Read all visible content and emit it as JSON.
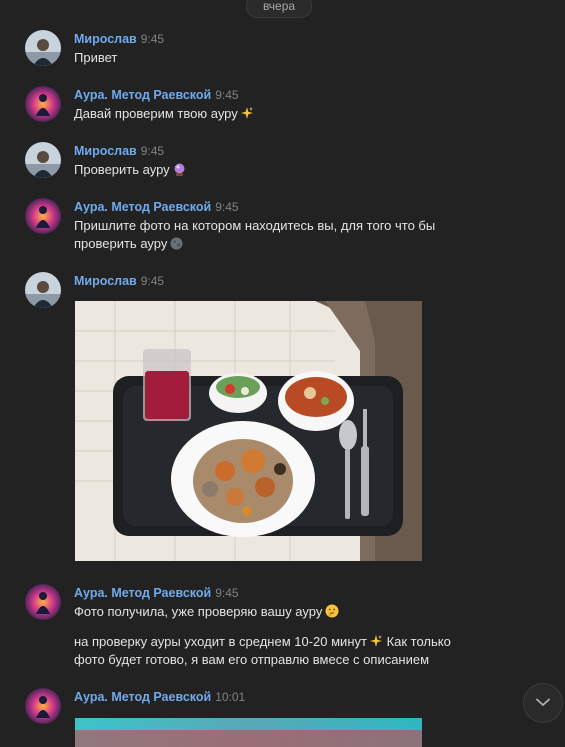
{
  "date_divider": "вчера",
  "messages": [
    {
      "author": "Мирослав",
      "time": "9:45",
      "text": "Привет"
    },
    {
      "author": "Аура. Метод Раевской",
      "time": "9:45",
      "text": "Давай проверим твою ауру"
    },
    {
      "author": "Мирослав",
      "time": "9:45",
      "text": "Проверить ауру"
    },
    {
      "author": "Аура. Метод Раевской",
      "time": "9:45",
      "text_line1": "Пришлите фото на котором находитесь вы, для того что бы",
      "text_line2": "проверить ауру"
    },
    {
      "author": "Мирослав",
      "time": "9:45"
    },
    {
      "author": "Аура. Метод Раевской",
      "time": "9:45",
      "text": "Фото получила, уже проверяю вашу ауру",
      "text2_line1": "на проверку ауры уходит в среднем 10-20 минут",
      "text2_line1b": "Как только",
      "text2_line2": "фото будет готово, я вам его отправлю вмесе с описанием"
    },
    {
      "author": "Аура. Метод Раевской",
      "time": "10:01"
    }
  ],
  "icons": {
    "sparkles": "sparkles-icon",
    "crystal_ball": "crystal-ball-icon",
    "moon": "moon-icon",
    "thinking": "thinking-face-icon",
    "scroll_down": "chevron-down-icon"
  },
  "colors": {
    "background": "#222222",
    "author": "#71aaeb",
    "text": "#e1e3e6",
    "time": "#828282"
  }
}
